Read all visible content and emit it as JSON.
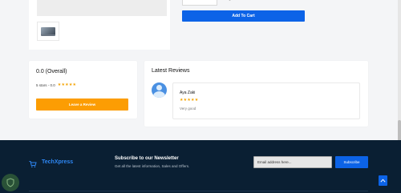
{
  "product": {
    "add_to_cart_label": "Add To Cart",
    "thumbnail_icon": "laptop-icon"
  },
  "rating": {
    "overall": "0.0 (Overall)",
    "stars_text": "5 stars - 0.0",
    "stars_glyphs": "★★★★★",
    "leave_review_label": "Leave a Review"
  },
  "reviews": {
    "title": "Latest Reviews",
    "items": [
      {
        "name": "Aya Zaki",
        "stars": "★★★★★",
        "text": "Very good"
      }
    ]
  },
  "footer": {
    "brand": "TechXpress",
    "newsletter_title": "Subscribe to our Newsletter",
    "newsletter_sub": "Get all the latest information, Sales and Offers.",
    "email_placeholder": "Email address here...",
    "subscribe_label": "Subscribe"
  },
  "colors": {
    "primary": "#0c63e7",
    "accent_orange": "#fc9d03",
    "star": "#f4a300",
    "footer_bg": "#0a1f33"
  }
}
